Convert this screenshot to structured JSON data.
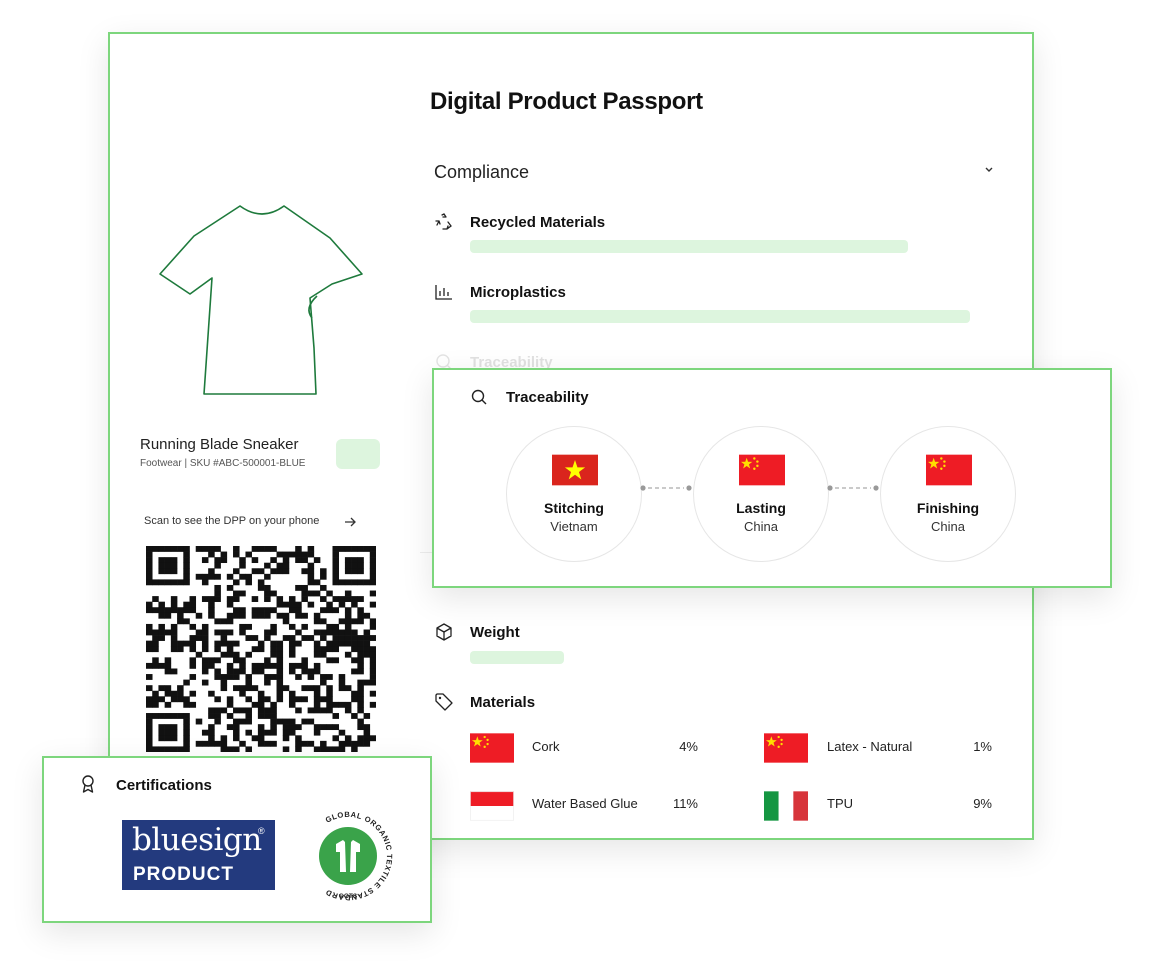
{
  "page": {
    "title": "Digital Product Passport"
  },
  "compliance": {
    "label": "Compliance",
    "metrics": [
      {
        "label": "Recycled Materials",
        "icon": "recycle-icon"
      },
      {
        "label": "Microplastics",
        "icon": "bar-chart-icon"
      },
      {
        "label": "Traceability",
        "icon": "search-icon"
      },
      {
        "label": "Weight",
        "icon": "box-icon"
      },
      {
        "label": "Materials",
        "icon": "tag-icon"
      }
    ]
  },
  "product": {
    "name": "Running Blade Sneaker",
    "meta": "Footwear | SKU #ABC-500001-BLUE",
    "scan_text": "Scan to see the DPP on your phone"
  },
  "traceability": {
    "title": "Traceability",
    "stages": [
      {
        "name": "Stitching",
        "country": "Vietnam",
        "flag": "vietnam-flag"
      },
      {
        "name": "Lasting",
        "country": "China",
        "flag": "china-flag"
      },
      {
        "name": "Finishing",
        "country": "China",
        "flag": "china-flag"
      }
    ]
  },
  "materials": {
    "items": [
      {
        "name": "Cork",
        "pct": "4%",
        "flag": "china-flag"
      },
      {
        "name": "Latex - Natural",
        "pct": "1%",
        "flag": "china-flag"
      },
      {
        "name": "Water Based Glue",
        "pct": "11%",
        "flag": "indonesia-flag"
      },
      {
        "name": "TPU",
        "pct": "9%",
        "flag": "italy-flag"
      }
    ]
  },
  "certifications": {
    "title": "Certifications",
    "bluesign": {
      "name": "bluesign",
      "reg": "®",
      "sub": "PRODUCT"
    },
    "gots": {
      "ring_text": "GLOBAL ORGANIC TEXTILE STANDARD",
      "abbr": "GOTS"
    }
  },
  "colors": {
    "border": "#7dd67d",
    "bar": "#ddf5de",
    "shirt": "#1e7a3c",
    "bluesign": "#233a7e",
    "gots_green": "#3aa34a",
    "china_red": "#ee1c25",
    "vietnam_red": "#da251d",
    "flag_yellow": "#ffde00"
  }
}
